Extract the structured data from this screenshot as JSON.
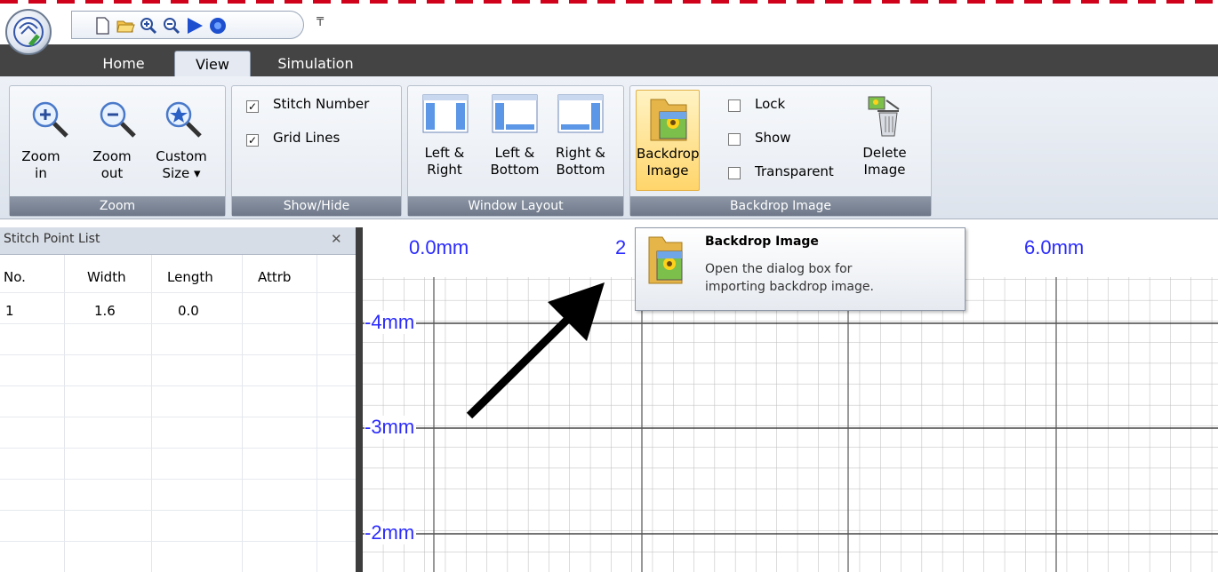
{
  "ribbon_tabs": {
    "home": "Home",
    "view": "View",
    "simulation": "Simulation"
  },
  "qat_more": "₸",
  "zoom_group": {
    "title": "Zoom",
    "zoom_in_line1": "Zoom",
    "zoom_in_line2": "in",
    "zoom_out_line1": "Zoom",
    "zoom_out_line2": "out",
    "custom_line1": "Custom",
    "custom_line2": "Size ▾"
  },
  "show_hide_group": {
    "title": "Show/Hide",
    "stitch_number": "Stitch Number",
    "stitch_number_checked": true,
    "grid_lines": "Grid Lines",
    "grid_lines_checked": true
  },
  "window_layout_group": {
    "title": "Window Layout",
    "lr_line1": "Left &",
    "lr_line2": "Right",
    "lb_line1": "Left &",
    "lb_line2": "Bottom",
    "rb_line1": "Right &",
    "rb_line2": "Bottom"
  },
  "backdrop_group": {
    "title": "Backdrop Image",
    "backdrop_line1": "Backdrop",
    "backdrop_line2": "Image",
    "lock": "Lock",
    "show": "Show",
    "transparent": "Transparent",
    "delete_line1": "Delete",
    "delete_line2": "Image"
  },
  "panel": {
    "title": "Stitch Point List",
    "close": "✕",
    "columns": [
      "No.",
      "Width",
      "Length",
      "Attrb"
    ],
    "rows": [
      [
        "1",
        "1.6",
        "0.0",
        ""
      ]
    ]
  },
  "canvas": {
    "x_labels": [
      "0.0mm",
      "2",
      "6.0mm"
    ],
    "y_labels": [
      "-4mm",
      "-3mm",
      "-2mm"
    ]
  },
  "tooltip": {
    "title": "Backdrop Image",
    "line1": "Open the dialog box for",
    "line2": "importing backdrop image."
  },
  "colors": {
    "accent_highlight": "#ffd56b",
    "tab_bar": "#444444",
    "ruler_text": "#2b2bff"
  }
}
